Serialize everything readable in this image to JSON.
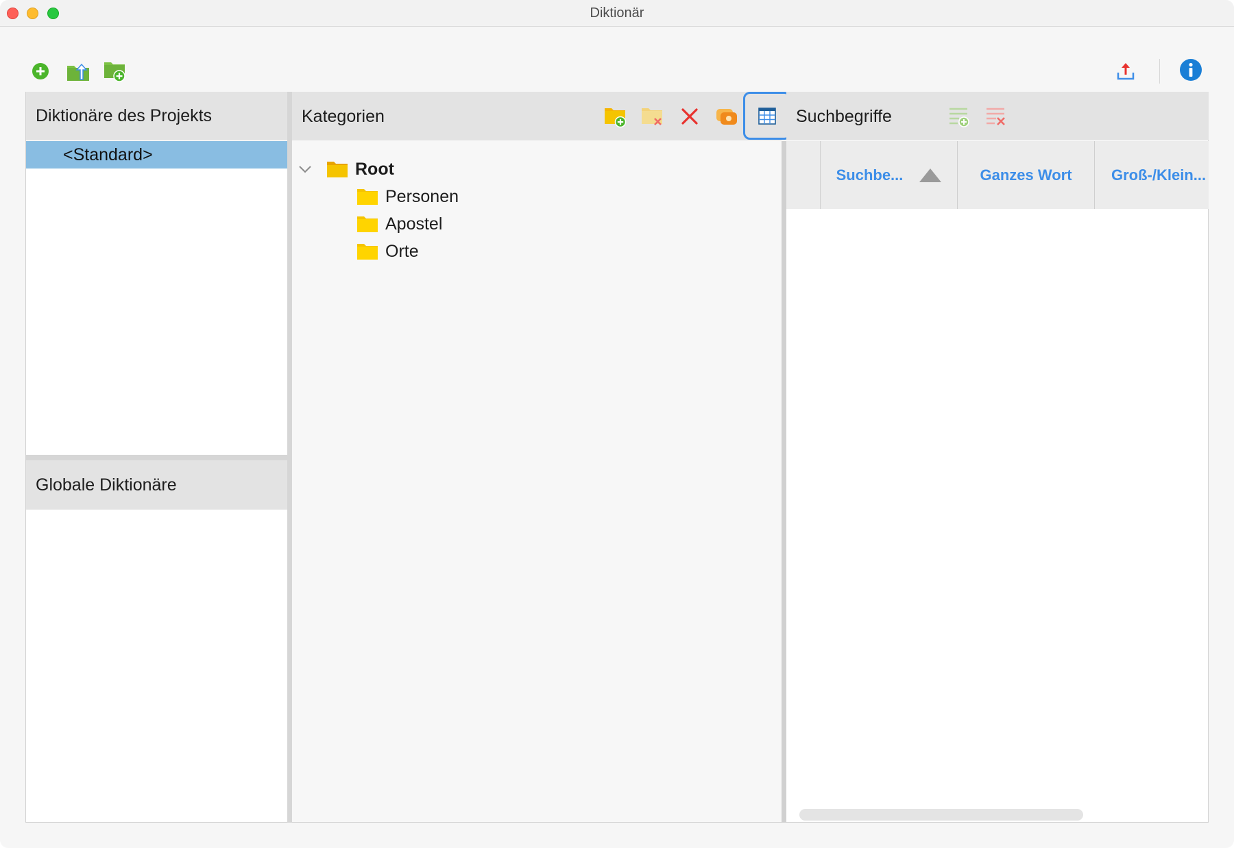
{
  "window": {
    "title": "Diktionär"
  },
  "toolbar": {
    "left_icons": [
      "add-dictionary-icon",
      "import-dictionary-icon",
      "new-dictionary-folder-icon"
    ],
    "right_icons": [
      "export-icon",
      "info-icon"
    ]
  },
  "project_dicts": {
    "header": "Diktionäre des Projekts",
    "items": [
      {
        "label": "<Standard>",
        "selected": true
      }
    ]
  },
  "global_dicts": {
    "header": "Globale Diktionäre",
    "items": []
  },
  "categories": {
    "header": "Kategorien",
    "tools": [
      "add-category-icon",
      "delete-category-folder-icon",
      "delete-icon",
      "color-icon",
      "table-view-icon"
    ],
    "selected_tool": "table-view-icon",
    "tree": {
      "root": {
        "label": "Root",
        "expanded": true
      },
      "children": [
        {
          "label": "Personen"
        },
        {
          "label": "Apostel"
        },
        {
          "label": "Orte"
        }
      ]
    }
  },
  "search_terms": {
    "header": "Suchbegriffe",
    "tools": [
      "add-term-icon",
      "delete-term-icon"
    ],
    "columns": [
      {
        "label": "Suchbe...",
        "sorted": "ascending"
      },
      {
        "label": "Ganzes Wort"
      },
      {
        "label": "Groß-/Klein..."
      }
    ],
    "rows": []
  },
  "colors": {
    "accent": "#3d8ee8",
    "selection": "#89bde2",
    "folder": "#f5c400",
    "delete": "#e8332f"
  }
}
